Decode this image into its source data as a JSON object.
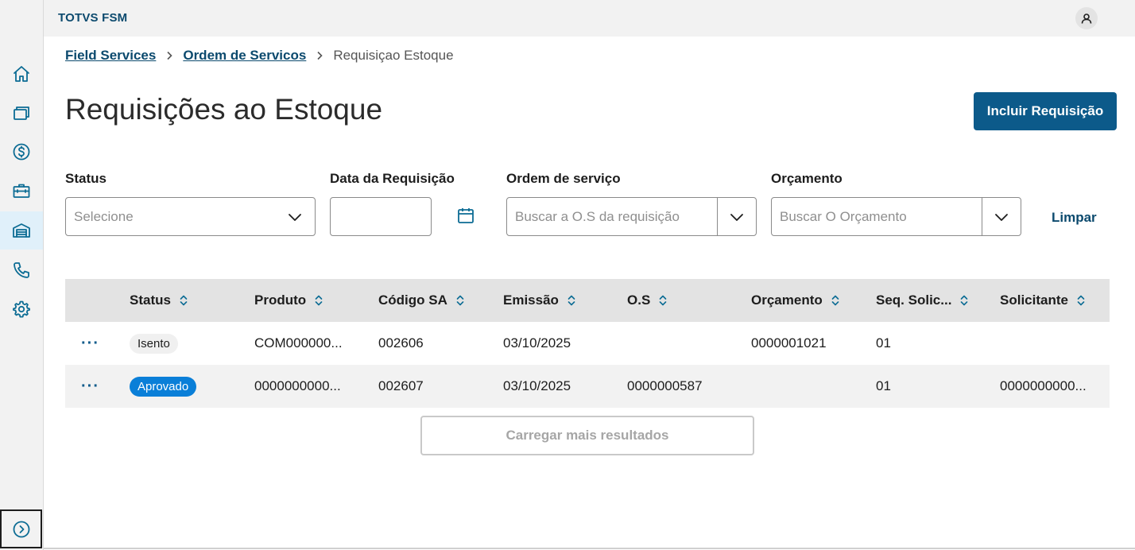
{
  "app": {
    "title": "TOTVS FSM"
  },
  "sidebar": {
    "items": [
      {
        "icon": "home-icon"
      },
      {
        "icon": "cards-icon"
      },
      {
        "icon": "dollar-icon"
      },
      {
        "icon": "briefcase-icon"
      },
      {
        "icon": "warehouse-icon",
        "active": true
      },
      {
        "icon": "phone-icon"
      },
      {
        "icon": "gear-icon"
      }
    ],
    "expand_icon": "chevron-right-circle-icon"
  },
  "breadcrumb": {
    "items": [
      "Field Services",
      "Ordem de Servicos"
    ],
    "current": "Requisiçao Estoque"
  },
  "page": {
    "title": "Requisições ao Estoque",
    "primary_button": "Incluir Requisição"
  },
  "filters": {
    "status": {
      "label": "Status",
      "placeholder": "Selecione"
    },
    "date": {
      "label": "Data da Requisição",
      "value": ""
    },
    "os": {
      "label": "Ordem de serviço",
      "placeholder": "Buscar a O.S da requisição"
    },
    "budget": {
      "label": "Orçamento",
      "placeholder": "Buscar O Orçamento"
    },
    "clear": "Limpar"
  },
  "table": {
    "columns": [
      "Status",
      "Produto",
      "Código SA",
      "Emissão",
      "O.S",
      "Orçamento",
      "Seq. Solic...",
      "Solicitante"
    ],
    "rows": [
      {
        "status": "Isento",
        "status_type": "neutral",
        "produto": "COM000000...",
        "codigo": "002606",
        "emissao": "03/10/2025",
        "os": "",
        "orcamento": "0000001021",
        "seq": "01",
        "solicitante": ""
      },
      {
        "status": "Aprovado",
        "status_type": "blue",
        "produto": "0000000000...",
        "codigo": "002607",
        "emissao": "03/10/2025",
        "os": "0000000587",
        "orcamento": "",
        "seq": "01",
        "solicitante": "0000000000..."
      }
    ],
    "actions_label": "···",
    "load_more": "Carregar mais resultados"
  },
  "colors": {
    "primary": "#0c5a8a",
    "link": "#0c4a6e",
    "badge_blue": "#0a7fd8"
  }
}
